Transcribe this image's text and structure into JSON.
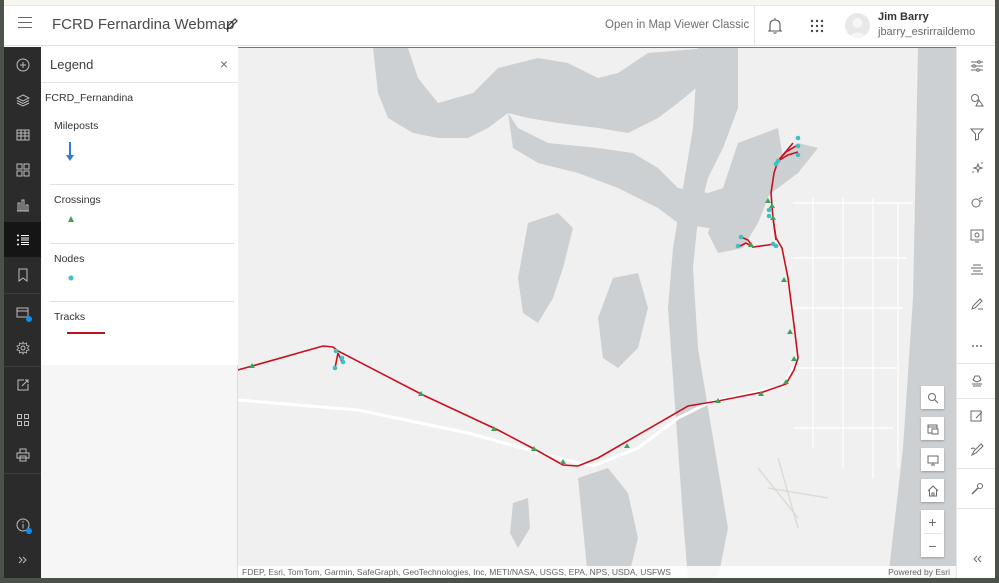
{
  "header": {
    "app_title": "FCRD Fernardina Webmap",
    "open_classic_label": "Open in Map Viewer Classic",
    "user": {
      "name": "Jim Barry",
      "username": "jbarry_esrirraildemo"
    }
  },
  "left_toolbar": {
    "items": [
      {
        "icon": "add-icon",
        "label": "Add"
      },
      {
        "icon": "layers-icon",
        "label": "Layers"
      },
      {
        "icon": "table-icon",
        "label": "Tables"
      },
      {
        "icon": "basemap-icon",
        "label": "Basemap"
      },
      {
        "icon": "charts-icon",
        "label": "Charts"
      },
      {
        "icon": "legend-icon",
        "label": "Legend",
        "active": true
      },
      {
        "icon": "bookmark-icon",
        "label": "Bookmarks"
      },
      {
        "icon": "save-icon",
        "label": "Save and open"
      },
      {
        "icon": "settings-icon",
        "label": "Map properties"
      },
      {
        "icon": "share-icon",
        "label": "Share map"
      },
      {
        "icon": "create-app-icon",
        "label": "Create app"
      },
      {
        "icon": "print-icon",
        "label": "Print"
      },
      {
        "icon": "info-icon",
        "label": "What's new"
      },
      {
        "icon": "expand-icon",
        "label": "Expand"
      }
    ]
  },
  "legend": {
    "title": "Legend",
    "close_symbol": "×",
    "layer_name": "FCRD_Fernandina",
    "entries": [
      {
        "label": "Mileposts",
        "symbol": "arrow-down",
        "color": "#2f7bd8"
      },
      {
        "label": "Crossings",
        "symbol": "triangle",
        "color": "#3aa655"
      },
      {
        "label": "Nodes",
        "symbol": "circle",
        "color": "#3cc0c0"
      },
      {
        "label": "Tracks",
        "symbol": "line",
        "color": "#b5151f"
      }
    ]
  },
  "map": {
    "attribution": "FDEP, Esri, TomTom, Garmin, SafeGraph, GeoTechnologies, Inc, METI/NASA, USGS, EPA, NPS, USDA, USFWS",
    "powered_by": "Powered by Esri",
    "controls": {
      "zoom_in": "+",
      "zoom_out": "−"
    },
    "track_color": "#c8101e",
    "crossing_color": "#3aa655",
    "node_color": "#3cc0c0",
    "water_color": "#cdd0d2",
    "land_color": "#f0f0f0"
  },
  "right_toolbar": {
    "items": [
      {
        "icon": "properties-icon",
        "label": "Properties"
      },
      {
        "icon": "styles-icon",
        "label": "Styles"
      },
      {
        "icon": "filter-icon",
        "label": "Filter"
      },
      {
        "icon": "effects-icon",
        "label": "Effects"
      },
      {
        "icon": "configure-popups-icon",
        "label": "Pop-ups"
      },
      {
        "icon": "fields-icon",
        "label": "Fields"
      },
      {
        "icon": "labels-icon",
        "label": "Labels"
      },
      {
        "icon": "edit-icon",
        "label": "Edit"
      },
      {
        "icon": "more-icon",
        "label": "More"
      },
      {
        "icon": "sketch-icon",
        "label": "Sketch"
      },
      {
        "icon": "map-notes-icon",
        "label": "Map notes"
      },
      {
        "icon": "draw-icon",
        "label": "Draw"
      },
      {
        "icon": "tools-icon",
        "label": "Tools"
      },
      {
        "icon": "collapse-icon",
        "label": "Collapse"
      }
    ]
  }
}
